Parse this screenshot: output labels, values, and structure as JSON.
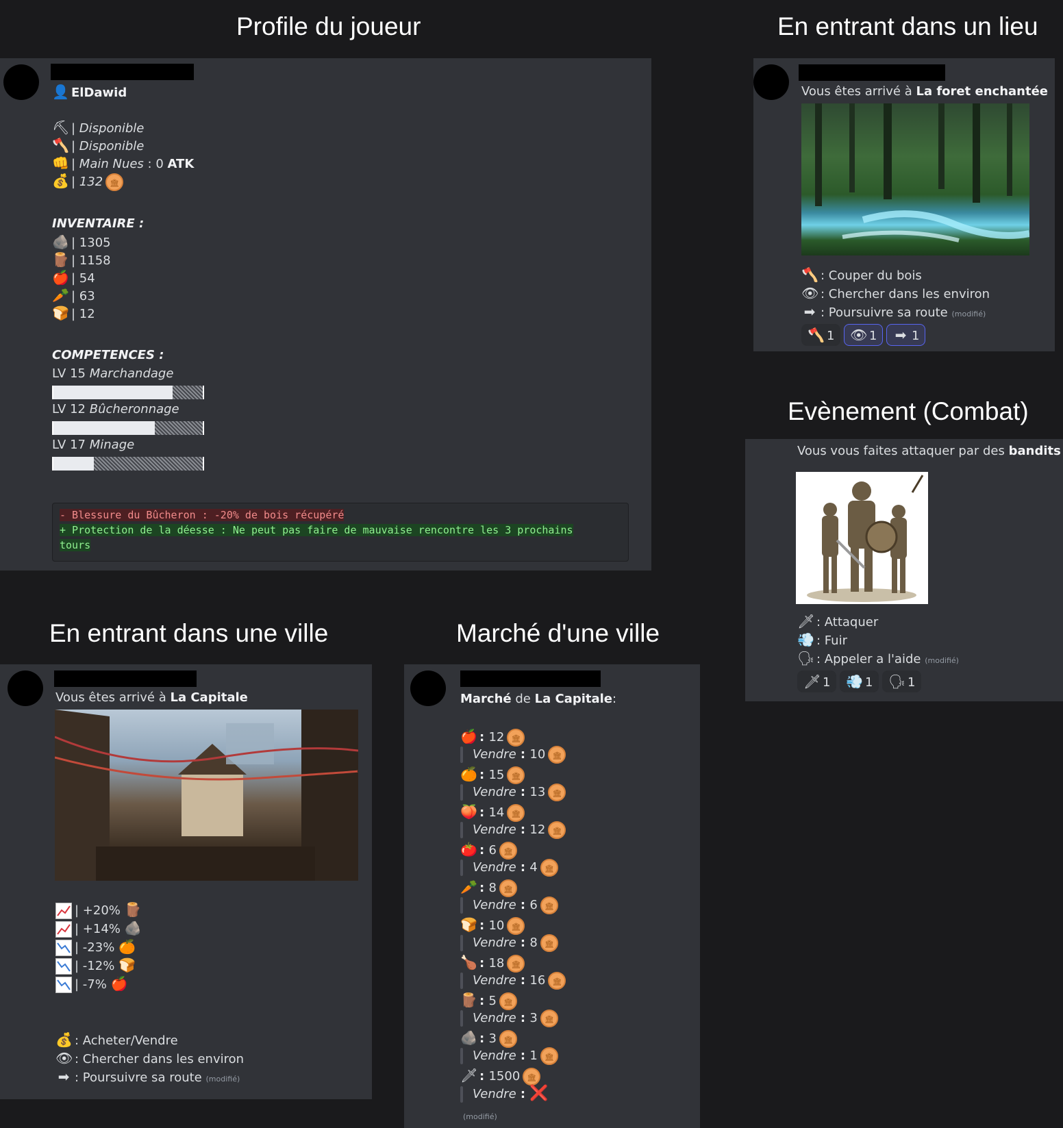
{
  "titles": {
    "profile": "Profile du joueur",
    "lieu": "En entrant dans un lieu",
    "combat": "Evènement (Combat)",
    "ville": "En entrant dans une ville",
    "marche": "Marché d'une ville"
  },
  "profile": {
    "username": "ElDawid",
    "status": [
      {
        "icon": "pickaxe-icon",
        "glyph": "⛏",
        "text": "Disponible"
      },
      {
        "icon": "axe-icon",
        "glyph": "🪓",
        "text": "Disponible"
      },
      {
        "icon": "fist-icon",
        "glyph": "👊",
        "text": "Main Nues",
        "extra": " : 0 ",
        "extra_bold": "ATK"
      },
      {
        "icon": "money-bag-icon",
        "glyph": "💰",
        "text": "132"
      }
    ],
    "inventory_title": "INVENTAIRE :",
    "inventory": [
      {
        "icon": "rock-icon",
        "glyph": "🪨",
        "value": "1305"
      },
      {
        "icon": "wood-icon",
        "glyph": "🪵",
        "value": "1158"
      },
      {
        "icon": "apple-icon",
        "glyph": "🍎",
        "value": "54"
      },
      {
        "icon": "carrot-icon",
        "glyph": "🥕",
        "value": "63"
      },
      {
        "icon": "bread-icon",
        "glyph": "🍞",
        "value": "12"
      }
    ],
    "skills_title": "COMPETENCES :",
    "skills": [
      {
        "level": "LV 15",
        "name": "Marchandage",
        "progress": 0.8
      },
      {
        "level": "LV 12",
        "name": "Bûcheronnage",
        "progress": 0.68
      },
      {
        "level": "LV 17",
        "name": "Minage",
        "progress": 0.27
      }
    ],
    "effects": [
      {
        "type": "neg",
        "text": "- Blessure du Bûcheron : -20% de bois récupéré"
      },
      {
        "type": "pos",
        "text": "+ Protection de la déesse : Ne peut pas faire de mauvaise rencontre les 3 prochains"
      },
      {
        "type": "pos",
        "text": "tours"
      }
    ]
  },
  "lieu": {
    "arrival_prefix": "Vous êtes arrivé à ",
    "arrival_place": "La foret enchantée",
    "actions": [
      {
        "icon": "axe-icon",
        "glyph": "🪓",
        "text": ": Couper du bois"
      },
      {
        "icon": "eye-icon",
        "glyph": "👁",
        "text": ": Chercher dans les environ"
      },
      {
        "icon": "arrow-right-icon",
        "glyph": "➡",
        "text": ": Poursuivre sa route",
        "modified": "(modifié)"
      }
    ],
    "reactions": [
      {
        "icon": "axe-icon",
        "glyph": "🪓",
        "count": "1",
        "active": false
      },
      {
        "icon": "eye-icon",
        "glyph": "👁",
        "count": "1",
        "active": true
      },
      {
        "icon": "arrow-right-icon",
        "glyph": "➡",
        "count": "1",
        "active": true
      }
    ]
  },
  "combat": {
    "text_prefix": "Vous vous faites attaquer par des ",
    "text_bold": "bandits",
    "text_suffix": " !",
    "actions": [
      {
        "icon": "dagger-icon",
        "glyph": "🗡",
        "text": ": Attaquer"
      },
      {
        "icon": "dash-icon",
        "glyph": "💨",
        "text": ": Fuir"
      },
      {
        "icon": "speaking-head-icon",
        "glyph": "🗣",
        "text": ": Appeler a l'aide",
        "modified": "(modifié)"
      }
    ],
    "reactions": [
      {
        "icon": "dagger-icon",
        "glyph": "🗡",
        "count": "1"
      },
      {
        "icon": "dash-icon",
        "glyph": "💨",
        "count": "1"
      },
      {
        "icon": "speaking-head-icon",
        "glyph": "🗣",
        "count": "1"
      }
    ]
  },
  "ville": {
    "arrival_prefix": "Vous êtes arrivé à ",
    "arrival_place": "La Capitale",
    "trends": [
      {
        "dir": "up",
        "text": "+20%",
        "icon": "wood-icon",
        "glyph": "🪵"
      },
      {
        "dir": "up",
        "text": "+14%",
        "icon": "rock-icon",
        "glyph": "🪨"
      },
      {
        "dir": "down",
        "text": "-23%",
        "icon": "orange-icon",
        "glyph": "🍊"
      },
      {
        "dir": "down",
        "text": "-12%",
        "icon": "bread-icon",
        "glyph": "🍞"
      },
      {
        "dir": "down",
        "text": "-7%",
        "icon": "apple-icon",
        "glyph": "🍎"
      }
    ],
    "actions": [
      {
        "icon": "money-bag-icon",
        "glyph": "💰",
        "text": ": Acheter/Vendre"
      },
      {
        "icon": "eye-icon",
        "glyph": "👁",
        "text": ": Chercher dans les environ"
      },
      {
        "icon": "arrow-right-icon",
        "glyph": "➡",
        "text": ": Poursuivre sa route",
        "modified": "(modifié)"
      }
    ]
  },
  "marche": {
    "title_bold": "Marché",
    "title_mid": " de ",
    "title_place": "La Capitale",
    "title_suffix": ":",
    "sell_label": "Vendre",
    "items": [
      {
        "icon": "apple-icon",
        "glyph": "🍎",
        "buy": "12",
        "sell": "10"
      },
      {
        "icon": "orange-icon",
        "glyph": "🍊",
        "buy": "15",
        "sell": "13"
      },
      {
        "icon": "peach-icon",
        "glyph": "🍑",
        "buy": "14",
        "sell": "12"
      },
      {
        "icon": "tomato-icon",
        "glyph": "🍅",
        "buy": "6",
        "sell": "4"
      },
      {
        "icon": "carrot-icon",
        "glyph": "🥕",
        "buy": "8",
        "sell": "6"
      },
      {
        "icon": "bread-icon",
        "glyph": "🍞",
        "buy": "10",
        "sell": "8"
      },
      {
        "icon": "meat-icon",
        "glyph": "🍗",
        "buy": "18",
        "sell": "16"
      },
      {
        "icon": "wood-icon",
        "glyph": "🪵",
        "buy": "5",
        "sell": "3"
      },
      {
        "icon": "rock-icon",
        "glyph": "🪨",
        "buy": "3",
        "sell": "1"
      },
      {
        "icon": "dagger-icon",
        "glyph": "🗡",
        "buy": "1500",
        "sell": "❌"
      }
    ],
    "modified": "(modifié)"
  }
}
